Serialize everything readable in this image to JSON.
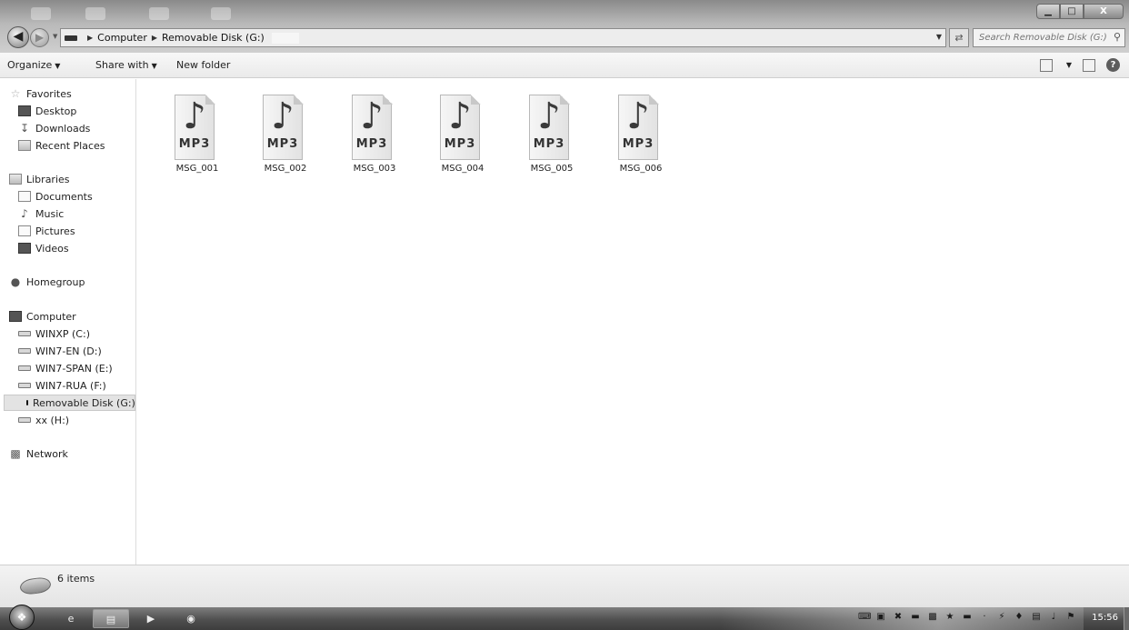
{
  "window": {
    "minimize_icon": "▁",
    "maximize_icon": "□",
    "close_icon": "X"
  },
  "address": {
    "crumbs": [
      "Computer",
      "Removable Disk (G:)"
    ],
    "search_placeholder": "Search Removable Disk (G:)"
  },
  "toolbar": {
    "organize": "Organize",
    "share_with": "Share with",
    "new_folder": "New folder"
  },
  "nav": {
    "favorites": "Favorites",
    "desktop": "Desktop",
    "downloads": "Downloads",
    "recent_places": "Recent Places",
    "libraries": "Libraries",
    "documents": "Documents",
    "music": "Music",
    "pictures": "Pictures",
    "videos": "Videos",
    "homegroup": "Homegroup",
    "computer": "Computer",
    "drives": [
      {
        "label": "WINXP (C:)"
      },
      {
        "label": "WIN7-EN (D:)"
      },
      {
        "label": "WIN7-SPAN (E:)"
      },
      {
        "label": "WIN7-RUA (F:)"
      },
      {
        "label": "Removable Disk (G:)",
        "selected": true
      },
      {
        "label": "xx (H:)"
      }
    ],
    "network": "Network"
  },
  "files": [
    {
      "name": "MSG_001",
      "ext": "MP3"
    },
    {
      "name": "MSG_002",
      "ext": "MP3"
    },
    {
      "name": "MSG_003",
      "ext": "MP3"
    },
    {
      "name": "MSG_004",
      "ext": "MP3"
    },
    {
      "name": "MSG_005",
      "ext": "MP3"
    },
    {
      "name": "MSG_006",
      "ext": "MP3"
    }
  ],
  "status": {
    "item_count": "6 items"
  },
  "taskbar": {
    "clock": "15:56"
  },
  "icons": {
    "back": "back-arrow-icon",
    "forward": "forward-arrow-icon",
    "search": "magnifier-icon",
    "help": "help-icon",
    "start": "windows-orb-icon",
    "file": "mp3-music-note-icon"
  }
}
